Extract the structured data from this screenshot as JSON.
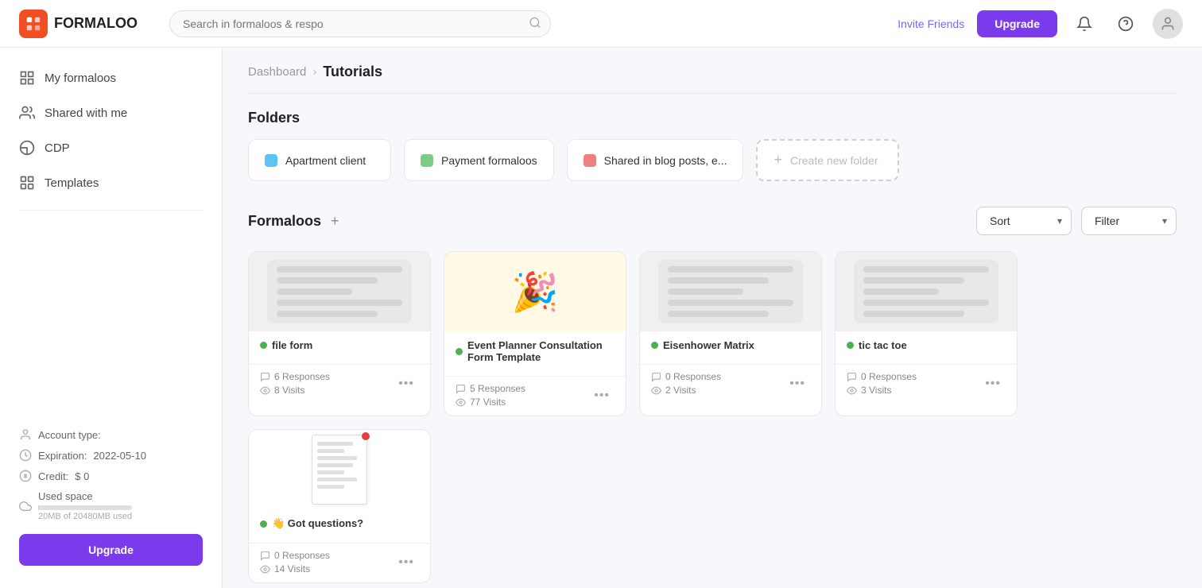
{
  "app": {
    "logo_text": "FORMALOO",
    "logo_icon_char": "F"
  },
  "topnav": {
    "search_placeholder": "Search in formaloos & respo",
    "invite_label": "Invite Friends",
    "upgrade_label": "Upgrade"
  },
  "sidebar": {
    "items": [
      {
        "id": "my-formaloos",
        "label": "My formaloos",
        "icon": "grid"
      },
      {
        "id": "shared-with-me",
        "label": "Shared with me",
        "icon": "users"
      },
      {
        "id": "cdp",
        "label": "CDP",
        "icon": "chart"
      },
      {
        "id": "templates",
        "label": "Templates",
        "icon": "apps"
      }
    ],
    "account": {
      "type_label": "Account type:",
      "type_value": "",
      "expiration_label": "Expiration:",
      "expiration_value": "2022-05-10",
      "credit_label": "Credit:",
      "credit_value": "$ 0",
      "used_space_label": "Used space",
      "used_space_value": "20MB of 20480MB used",
      "storage_percent": 1
    },
    "upgrade_label": "Upgrade"
  },
  "breadcrumb": {
    "parent": "Dashboard",
    "separator": "›",
    "current": "Tutorials"
  },
  "folders_section": {
    "title": "Folders",
    "items": [
      {
        "id": "apartment",
        "label": "Apartment client",
        "color": "#5bc4f5"
      },
      {
        "id": "payment",
        "label": "Payment formaloos",
        "color": "#7ecb83"
      },
      {
        "id": "shared-blog",
        "label": "Shared in blog posts, e...",
        "color": "#f08080"
      }
    ],
    "create_label": "Create new folder",
    "create_plus": "+"
  },
  "formaloos_section": {
    "title": "Formaloos",
    "plus_label": "+",
    "sort_label": "Sort",
    "filter_label": "Filter",
    "cards": [
      {
        "id": "file-form",
        "name": "file form",
        "status_color": "#4caf50",
        "thumb_type": "grey",
        "responses": "6 Responses",
        "visits": "8 Visits"
      },
      {
        "id": "event-planner",
        "name": "Event Planner Consultation Form Template",
        "status_color": "#4caf50",
        "thumb_type": "party",
        "responses": "5 Responses",
        "visits": "77 Visits"
      },
      {
        "id": "eisenhower",
        "name": "Eisenhower Matrix",
        "status_color": "#4caf50",
        "thumb_type": "grey",
        "responses": "0 Responses",
        "visits": "2 Visits"
      },
      {
        "id": "tic-tac-toe",
        "name": "tic tac toe",
        "status_color": "#4caf50",
        "thumb_type": "grey",
        "responses": "0 Responses",
        "visits": "3 Visits"
      },
      {
        "id": "got-questions",
        "name": "👋 Got questions?",
        "status_color": "#4caf50",
        "thumb_type": "doc",
        "responses": "0 Responses",
        "visits": "14 Visits"
      }
    ]
  },
  "icons": {
    "search": "🔍",
    "bell": "🔔",
    "question": "❓",
    "user": "👤",
    "responses": "↩",
    "visits": "👁",
    "more": "•••",
    "plus": "+"
  }
}
